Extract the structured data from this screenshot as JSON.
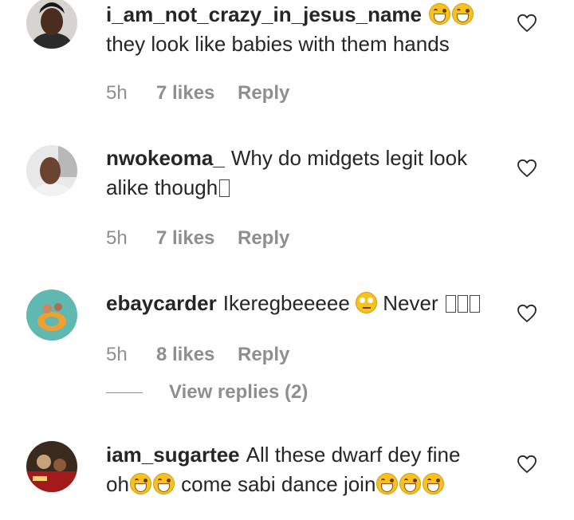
{
  "comments": [
    {
      "username": "i_am_not_crazy_in_jesus_name",
      "text_line1_after": "",
      "text_line2": "they look like babies with them hands",
      "time": "5h",
      "likes": "7 likes",
      "reply": "Reply"
    },
    {
      "username": "nwokeoma_",
      "text_line1": "Why do midgets legit look",
      "text_line2": "alike though",
      "time": "5h",
      "likes": "7 likes",
      "reply": "Reply"
    },
    {
      "username": "ebaycarder",
      "text_part1": "Ikeregbeeeee",
      "text_part2": "Never",
      "time": "5h",
      "likes": "8 likes",
      "reply": "Reply",
      "view_replies": "View replies (2)"
    },
    {
      "username": "iam_sugartee",
      "text_line1": "All these dwarf dey fine",
      "text_line2_part1": "oh",
      "text_line2_part2": "come sabi dance join"
    }
  ],
  "icons": {
    "like": "heart-outline-icon",
    "laugh_emoji": "grinning-squinting-face-emoji",
    "eyeroll_emoji": "face-with-rolling-eyes-emoji"
  },
  "colors": {
    "text": "#262626",
    "secondary": "#8e8e8e",
    "background": "#ffffff"
  }
}
